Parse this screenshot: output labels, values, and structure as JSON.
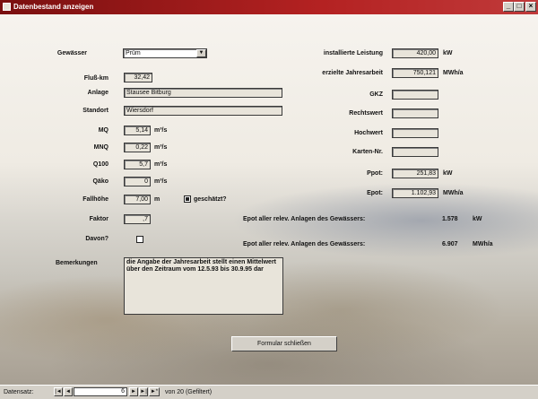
{
  "window": {
    "title": "Datenbestand anzeigen",
    "min": "_",
    "max": "□",
    "close": "×"
  },
  "form": {
    "gewaesser": {
      "label": "Gewässer",
      "value": "Prüm"
    },
    "flusskm": {
      "label": "Fluß-km",
      "value": "32,42"
    },
    "anlage": {
      "label": "Anlage",
      "value": "Stausee Bitburg"
    },
    "standort": {
      "label": "Standort",
      "value": "Wiersdorf"
    },
    "mq": {
      "label": "MQ",
      "value": "5,14",
      "unit": "m³/s"
    },
    "mnq": {
      "label": "MNQ",
      "value": "0,22",
      "unit": "m³/s"
    },
    "q100": {
      "label": "Q100",
      "value": "5,7",
      "unit": "m³/s"
    },
    "qaku": {
      "label": "Qäko",
      "value": "0",
      "unit": "m³/s"
    },
    "fallhoehe": {
      "label": "Fallhöhe",
      "value": "7,00",
      "unit": "m",
      "check_label": "geschätzt?"
    },
    "faktor": {
      "label": "Faktor",
      "value": ",7"
    },
    "davon": {
      "label": "Davon?"
    },
    "bemerkungen": {
      "label": "Bemerkungen",
      "text": "die Angabe der Jahresarbeit stellt einen Mittelwert über den Zeitraum vom 12.5.93 bis 30.9.95 dar"
    },
    "leistung": {
      "label": "installierte Leistung",
      "value": "420,00",
      "unit": "kW"
    },
    "jahresarbeit": {
      "label": "erzielte Jahresarbeit",
      "value": "750,121",
      "unit": "MWh/a"
    },
    "gkz": {
      "label": "GKZ",
      "value": ""
    },
    "rechtswert": {
      "label": "Rechtswert",
      "value": ""
    },
    "hochwert": {
      "label": "Hochwert",
      "value": ""
    },
    "kartennr": {
      "label": "Karten-Nr.",
      "value": ""
    },
    "ppot": {
      "label": "Ppot:",
      "value": "251,83",
      "unit": "kW"
    },
    "epot": {
      "label": "Epot:",
      "value": "1.102,93",
      "unit": "MWh/a"
    },
    "ppot_all": {
      "label": "Epot aller relev. Anlagen des Gewässers:",
      "value": "1.578",
      "unit": "kW"
    },
    "epot_all": {
      "label": "Epot aller relev. Anlagen des Gewässers:",
      "value": "6.907",
      "unit": "MWh/a"
    },
    "close_button": "Formular schließen"
  },
  "navbar": {
    "label": "Datensatz:",
    "current": "6",
    "of_text": "von  20 (Gefiltert)",
    "first": "|◄",
    "prev": "◄",
    "next": "►",
    "last": "►|",
    "new": "►*"
  }
}
